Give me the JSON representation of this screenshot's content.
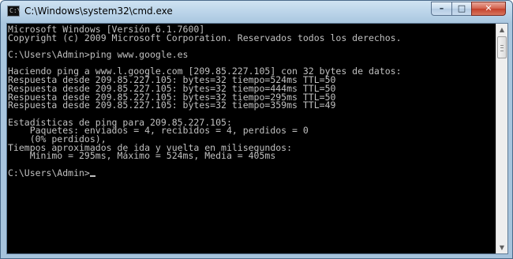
{
  "window": {
    "title": "C:\\Windows\\system32\\cmd.exe",
    "icon_text": "C:\\",
    "controls": {
      "minimize": "–",
      "maximize": "□",
      "close": "✕"
    }
  },
  "console": {
    "lines": [
      "Microsoft Windows [Versión 6.1.7600]",
      "Copyright (c) 2009 Microsoft Corporation. Reservados todos los derechos.",
      "",
      "C:\\Users\\Admin>ping www.google.es",
      "",
      "Haciendo ping a www.l.google.com [209.85.227.105] con 32 bytes de datos:",
      "Respuesta desde 209.85.227.105: bytes=32 tiempo=524ms TTL=50",
      "Respuesta desde 209.85.227.105: bytes=32 tiempo=444ms TTL=50",
      "Respuesta desde 209.85.227.105: bytes=32 tiempo=295ms TTL=50",
      "Respuesta desde 209.85.227.105: bytes=32 tiempo=359ms TTL=49",
      "",
      "Estadísticas de ping para 209.85.227.105:",
      "    Paquetes: enviados = 4, recibidos = 4, perdidos = 0",
      "    (0% perdidos),",
      "Tiempos aproximados de ida y vuelta en milisegundos:",
      "    Mínimo = 295ms, Máximo = 524ms, Media = 405ms",
      "",
      "C:\\Users\\Admin>"
    ]
  },
  "scrollbar": {
    "up_arrow": "▲",
    "down_arrow": "▼"
  },
  "colors": {
    "console_background": "#000000",
    "console_text": "#c0c0c0",
    "title_bar": "#b9d3e8",
    "close_button": "#c4402a"
  }
}
